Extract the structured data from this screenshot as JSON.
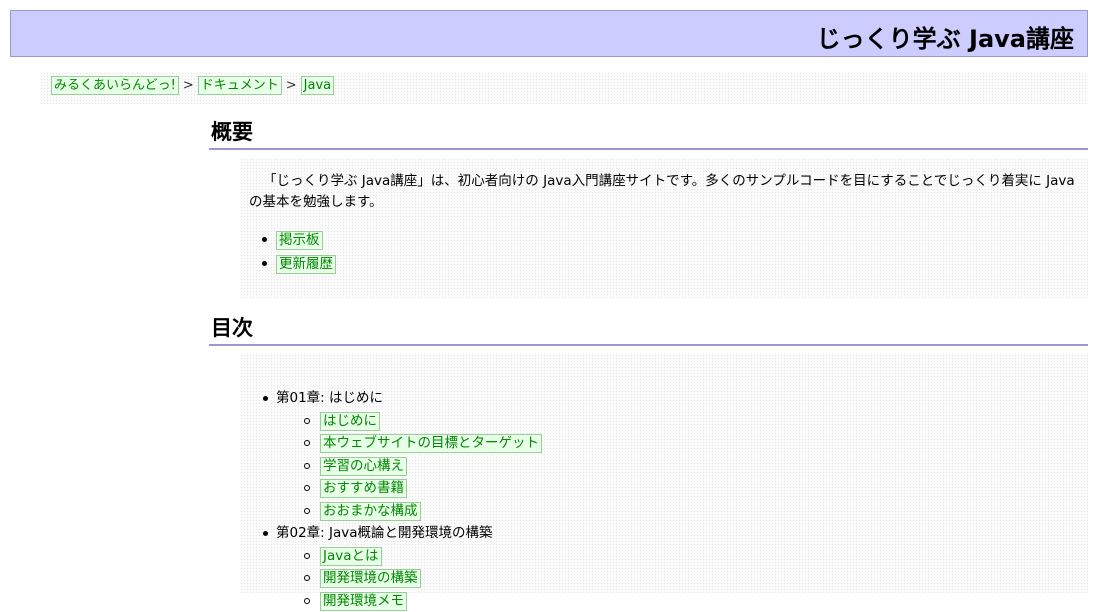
{
  "header": {
    "title": "じっくり学ぶ Java講座"
  },
  "breadcrumb": [
    {
      "label": "みるくあいらんどっ!"
    },
    {
      "label": "ドキュメント"
    },
    {
      "label": "Java"
    }
  ],
  "breadcrumb_separator": ">",
  "overview": {
    "heading": "概要",
    "text": "「じっくり学ぶ Java講座」は、初心者向けの Java入門講座サイトです。多くのサンプルコードを目にすることでじっくり着実に Javaの基本を勉強します。",
    "links": [
      {
        "label": "掲示板"
      },
      {
        "label": "更新履歴"
      }
    ]
  },
  "toc": {
    "heading": "目次",
    "chapters": [
      {
        "title": "第01章: はじめに",
        "items": [
          {
            "label": "はじめに"
          },
          {
            "label": "本ウェブサイトの目標とターゲット"
          },
          {
            "label": "学習の心構え"
          },
          {
            "label": "おすすめ書籍"
          },
          {
            "label": "おおまかな構成"
          }
        ]
      },
      {
        "title": "第02章: Java概論と開発環境の構築",
        "items": [
          {
            "label": "Javaとは"
          },
          {
            "label": "開発環境の構築"
          },
          {
            "label": "開発環境メモ"
          }
        ]
      }
    ]
  },
  "colors": {
    "header_bg": "#ccccff",
    "heading_rule": "#9999cc",
    "link_text": "#008800",
    "link_bg": "#e8ffe8",
    "link_border": "#9acd9a"
  }
}
